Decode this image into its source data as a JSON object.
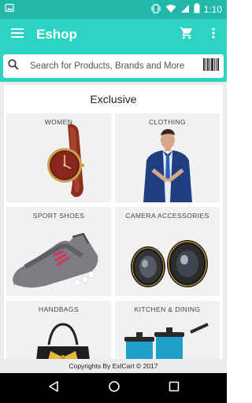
{
  "status_bar": {
    "time": "1:10"
  },
  "app_bar": {
    "title": "Eshop"
  },
  "search": {
    "placeholder": "Search for Products, Brands and More"
  },
  "section": {
    "title": "Exclusive"
  },
  "categories": [
    {
      "label": "WOMEN"
    },
    {
      "label": "CLOTHING"
    },
    {
      "label": "SPORT SHOES"
    },
    {
      "label": "CAMERA ACCESSORIES"
    },
    {
      "label": "HANDBAGS"
    },
    {
      "label": "KITCHEN & DINING"
    }
  ],
  "footer": {
    "text": "Copyrights By ExlCart © 2017"
  },
  "colors": {
    "status_bar": "#21b8aa",
    "app_bar": "#2dd3c3",
    "tile_bg": "#f1f1f4",
    "nav_bar": "#000000"
  },
  "icons": [
    "gallery-icon",
    "vibrate-icon",
    "wifi-icon",
    "signal-icon",
    "battery-icon",
    "menu-icon",
    "cart-icon",
    "more-vert-icon",
    "search-icon",
    "barcode-icon",
    "back-icon",
    "home-icon",
    "recents-icon"
  ]
}
